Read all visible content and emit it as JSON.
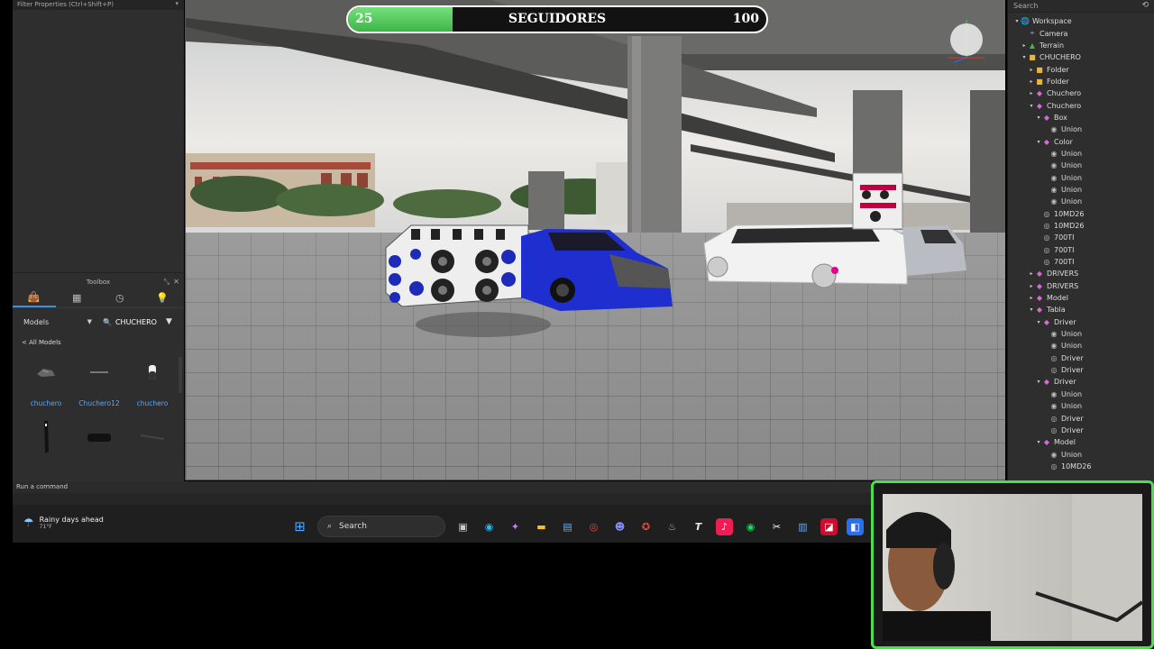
{
  "left_panel": {
    "filter_title": "Filter Properties (Ctrl+Shift+P)"
  },
  "toolbox": {
    "title": "Toolbox",
    "category": "Models",
    "search_value": "CHUCHERO",
    "all_models_link": "< All Models",
    "items": [
      {
        "label": "chuchero"
      },
      {
        "label": "Chuchero12"
      },
      {
        "label": "chuchero"
      },
      {
        "label": ""
      },
      {
        "label": ""
      },
      {
        "label": ""
      }
    ]
  },
  "viewport": {
    "follower_bar": {
      "start": "25",
      "title": "SEGUIDORES",
      "end": "100",
      "progress": 0.25,
      "fill_color": "#4cc455"
    }
  },
  "explorer": {
    "search_placeholder": "Search",
    "tree": [
      {
        "label": "Workspace",
        "depth": 0,
        "toggle": "▾",
        "icon": "🌐",
        "color": "#5aa7ff"
      },
      {
        "label": "Camera",
        "depth": 1,
        "toggle": "",
        "icon": "⌖",
        "color": "#9ad"
      },
      {
        "label": "Terrain",
        "depth": 1,
        "toggle": "▸",
        "icon": "▲",
        "color": "#4caf50"
      },
      {
        "label": "CHUCHERO",
        "depth": 1,
        "toggle": "▾",
        "icon": "■",
        "color": "#e8b43a"
      },
      {
        "label": "Folder",
        "depth": 2,
        "toggle": "▸",
        "icon": "■",
        "color": "#e8b43a"
      },
      {
        "label": "Folder",
        "depth": 2,
        "toggle": "▸",
        "icon": "■",
        "color": "#e8b43a"
      },
      {
        "label": "Chuchero",
        "depth": 2,
        "toggle": "▸",
        "icon": "◆",
        "color": "#d46ad6"
      },
      {
        "label": "Chuchero",
        "depth": 2,
        "toggle": "▾",
        "icon": "◆",
        "color": "#d46ad6"
      },
      {
        "label": "Box",
        "depth": 3,
        "toggle": "▾",
        "icon": "◆",
        "color": "#d46ad6"
      },
      {
        "label": "Union",
        "depth": 4,
        "toggle": "",
        "icon": "◉",
        "color": "#bbb"
      },
      {
        "label": "Color",
        "depth": 3,
        "toggle": "▾",
        "icon": "◆",
        "color": "#d46ad6"
      },
      {
        "label": "Union",
        "depth": 4,
        "toggle": "",
        "icon": "◉",
        "color": "#bbb"
      },
      {
        "label": "Union",
        "depth": 4,
        "toggle": "",
        "icon": "◉",
        "color": "#bbb"
      },
      {
        "label": "Union",
        "depth": 4,
        "toggle": "",
        "icon": "◉",
        "color": "#bbb"
      },
      {
        "label": "Union",
        "depth": 4,
        "toggle": "",
        "icon": "◉",
        "color": "#bbb"
      },
      {
        "label": "Union",
        "depth": 4,
        "toggle": "",
        "icon": "◉",
        "color": "#bbb"
      },
      {
        "label": "10MD26",
        "depth": 3,
        "toggle": "",
        "icon": "◎",
        "color": "#bbb"
      },
      {
        "label": "10MD26",
        "depth": 3,
        "toggle": "",
        "icon": "◎",
        "color": "#bbb"
      },
      {
        "label": "700TI",
        "depth": 3,
        "toggle": "",
        "icon": "◎",
        "color": "#bbb"
      },
      {
        "label": "700TI",
        "depth": 3,
        "toggle": "",
        "icon": "◎",
        "color": "#bbb"
      },
      {
        "label": "700TI",
        "depth": 3,
        "toggle": "",
        "icon": "◎",
        "color": "#bbb"
      },
      {
        "label": "DRIVERS",
        "depth": 2,
        "toggle": "▸",
        "icon": "◆",
        "color": "#d46ad6"
      },
      {
        "label": "DRIVERS",
        "depth": 2,
        "toggle": "▸",
        "icon": "◆",
        "color": "#d46ad6"
      },
      {
        "label": "Model",
        "depth": 2,
        "toggle": "▸",
        "icon": "◆",
        "color": "#d46ad6"
      },
      {
        "label": "Tabla",
        "depth": 2,
        "toggle": "▾",
        "icon": "◆",
        "color": "#d46ad6"
      },
      {
        "label": "Driver",
        "depth": 3,
        "toggle": "▾",
        "icon": "◆",
        "color": "#d46ad6"
      },
      {
        "label": "Union",
        "depth": 4,
        "toggle": "",
        "icon": "◉",
        "color": "#bbb"
      },
      {
        "label": "Union",
        "depth": 4,
        "toggle": "",
        "icon": "◉",
        "color": "#bbb"
      },
      {
        "label": "Driver",
        "depth": 4,
        "toggle": "",
        "icon": "◎",
        "color": "#bbb"
      },
      {
        "label": "Driver",
        "depth": 4,
        "toggle": "",
        "icon": "◎",
        "color": "#bbb"
      },
      {
        "label": "Driver",
        "depth": 3,
        "toggle": "▾",
        "icon": "◆",
        "color": "#d46ad6"
      },
      {
        "label": "Union",
        "depth": 4,
        "toggle": "",
        "icon": "◉",
        "color": "#bbb"
      },
      {
        "label": "Union",
        "depth": 4,
        "toggle": "",
        "icon": "◉",
        "color": "#bbb"
      },
      {
        "label": "Driver",
        "depth": 4,
        "toggle": "",
        "icon": "◎",
        "color": "#bbb"
      },
      {
        "label": "Driver",
        "depth": 4,
        "toggle": "",
        "icon": "◎",
        "color": "#bbb"
      },
      {
        "label": "Model",
        "depth": 3,
        "toggle": "▾",
        "icon": "◆",
        "color": "#d46ad6"
      },
      {
        "label": "Union",
        "depth": 4,
        "toggle": "",
        "icon": "◉",
        "color": "#bbb"
      },
      {
        "label": "10MD26",
        "depth": 4,
        "toggle": "",
        "icon": "◎",
        "color": "#bbb"
      }
    ]
  },
  "command_bar": {
    "placeholder": "Run a command"
  },
  "taskbar": {
    "weather_text": "Rainy days ahead",
    "weather_temp": "71°F",
    "search_label": "Search"
  }
}
